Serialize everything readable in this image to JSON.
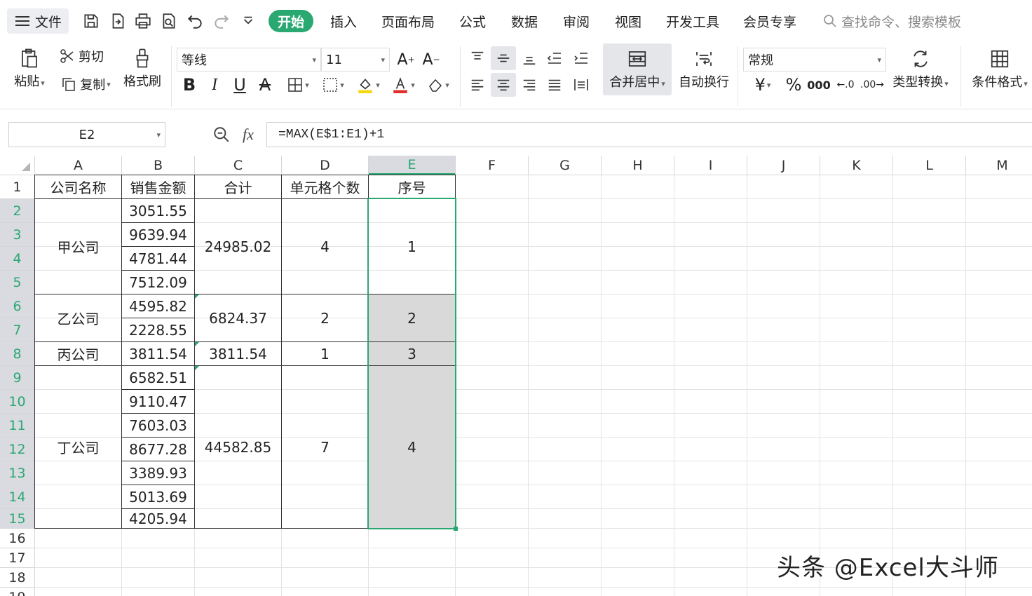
{
  "menubar": {
    "file_label": "文件",
    "tabs": [
      "开始",
      "插入",
      "页面布局",
      "公式",
      "数据",
      "审阅",
      "视图",
      "开发工具",
      "会员专享"
    ],
    "active_tab": "开始",
    "search_placeholder": "查找命令、搜索模板"
  },
  "ribbon": {
    "paste": "粘贴",
    "cut": "剪切",
    "copy": "复制",
    "format_painter": "格式刷",
    "font_name": "等线",
    "font_size": "11",
    "merge_center": "合并居中",
    "wrap_text": "自动换行",
    "number_format": "常规",
    "type_convert": "类型转换",
    "conditional_format": "条件格式"
  },
  "formula_bar": {
    "name_box": "E2",
    "fx": "fx",
    "formula": "=MAX(E$1:E1)+1"
  },
  "sheet": {
    "columns": [
      "A",
      "B",
      "C",
      "D",
      "E",
      "F",
      "G",
      "H",
      "I",
      "J",
      "K",
      "L",
      "M"
    ],
    "rows": [
      "1",
      "2",
      "3",
      "4",
      "5",
      "6",
      "7",
      "8",
      "9",
      "10",
      "11",
      "12",
      "13",
      "14",
      "15",
      "16",
      "17",
      "18",
      "19"
    ],
    "selected_column": "E",
    "headers": {
      "a": "公司名称",
      "b": "销售金额",
      "c": "合计",
      "d": "单元格个数",
      "e": "序号"
    },
    "groups": [
      {
        "company": "甲公司",
        "total": "24985.02",
        "count": "4",
        "seq": "1"
      },
      {
        "company": "乙公司",
        "total": "6824.37",
        "count": "2",
        "seq": "2"
      },
      {
        "company": "丙公司",
        "total": "3811.54",
        "count": "1",
        "seq": "3"
      },
      {
        "company": "丁公司",
        "total": "44582.85",
        "count": "7",
        "seq": "4"
      }
    ],
    "sales": [
      "3051.55",
      "9639.94",
      "4781.44",
      "7512.09",
      "4595.82",
      "2228.55",
      "3811.54",
      "6582.51",
      "9110.47",
      "7603.03",
      "8677.28",
      "3389.93",
      "5013.69",
      "4205.94"
    ]
  },
  "watermark": "头条 @Excel大斗师",
  "colors": {
    "accent": "#2aa871",
    "shade": "#d9d9d9",
    "header_sel": "#d9dbe0"
  }
}
